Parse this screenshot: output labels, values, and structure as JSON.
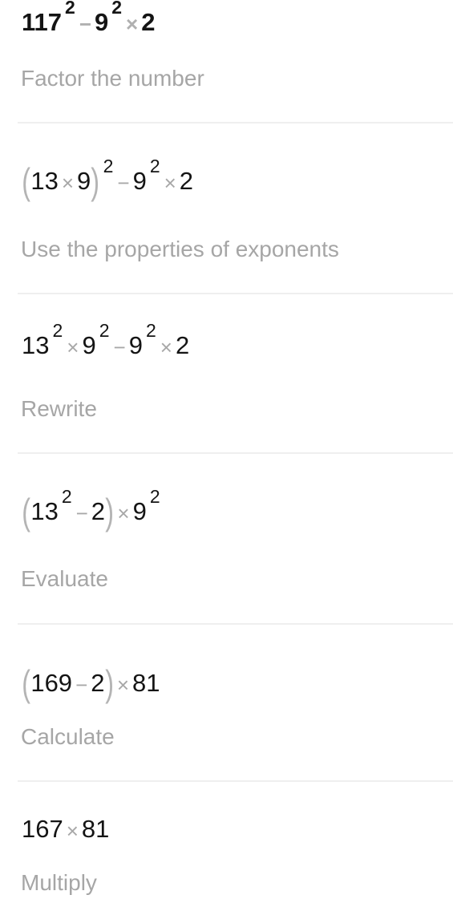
{
  "steps": [
    {
      "tokens": [
        {
          "t": "num",
          "v": "117"
        },
        {
          "t": "sup",
          "v": "2"
        },
        {
          "t": "op",
          "v": "−"
        },
        {
          "t": "num",
          "v": "9"
        },
        {
          "t": "sup",
          "v": "2"
        },
        {
          "t": "op",
          "v": "×"
        },
        {
          "t": "num",
          "v": "2"
        }
      ],
      "expression_text": "117^2 − 9^2 × 2",
      "description": "Factor the number"
    },
    {
      "tokens": [
        {
          "t": "paren",
          "v": "("
        },
        {
          "t": "num",
          "v": "13"
        },
        {
          "t": "op",
          "v": "×"
        },
        {
          "t": "num",
          "v": "9"
        },
        {
          "t": "paren",
          "v": ")"
        },
        {
          "t": "sup",
          "v": "2"
        },
        {
          "t": "op",
          "v": "−"
        },
        {
          "t": "num",
          "v": "9"
        },
        {
          "t": "sup",
          "v": "2"
        },
        {
          "t": "op",
          "v": "×"
        },
        {
          "t": "num",
          "v": "2"
        }
      ],
      "expression_text": "(13 × 9)^2 − 9^2 × 2",
      "description": "Use the properties of exponents"
    },
    {
      "tokens": [
        {
          "t": "num",
          "v": "13"
        },
        {
          "t": "sup",
          "v": "2"
        },
        {
          "t": "op",
          "v": "×"
        },
        {
          "t": "num",
          "v": "9"
        },
        {
          "t": "sup",
          "v": "2"
        },
        {
          "t": "op",
          "v": "−"
        },
        {
          "t": "num",
          "v": "9"
        },
        {
          "t": "sup",
          "v": "2"
        },
        {
          "t": "op",
          "v": "×"
        },
        {
          "t": "num",
          "v": "2"
        }
      ],
      "expression_text": "13^2 × 9^2 − 9^2 × 2",
      "description": "Rewrite"
    },
    {
      "tokens": [
        {
          "t": "paren",
          "v": "("
        },
        {
          "t": "num",
          "v": "13"
        },
        {
          "t": "sup",
          "v": "2"
        },
        {
          "t": "op",
          "v": "−"
        },
        {
          "t": "num",
          "v": "2"
        },
        {
          "t": "paren",
          "v": ")"
        },
        {
          "t": "op",
          "v": "×"
        },
        {
          "t": "num",
          "v": "9"
        },
        {
          "t": "sup",
          "v": "2"
        }
      ],
      "expression_text": "(13^2 − 2) × 9^2",
      "description": "Evaluate"
    },
    {
      "tokens": [
        {
          "t": "paren",
          "v": "("
        },
        {
          "t": "num",
          "v": "169"
        },
        {
          "t": "op",
          "v": "−"
        },
        {
          "t": "num",
          "v": "2"
        },
        {
          "t": "paren",
          "v": ")"
        },
        {
          "t": "op",
          "v": "×"
        },
        {
          "t": "num",
          "v": "81"
        }
      ],
      "expression_text": "(169 − 2) × 81",
      "description": "Calculate"
    },
    {
      "tokens": [
        {
          "t": "num",
          "v": "167"
        },
        {
          "t": "op",
          "v": "×"
        },
        {
          "t": "num",
          "v": "81"
        }
      ],
      "expression_text": "167 × 81",
      "description": "Multiply"
    }
  ],
  "colors": {
    "number": "#141414",
    "operator": "#a8a8a8",
    "description": "#a6a6a6",
    "divider": "#efefef",
    "background": "#ffffff"
  }
}
